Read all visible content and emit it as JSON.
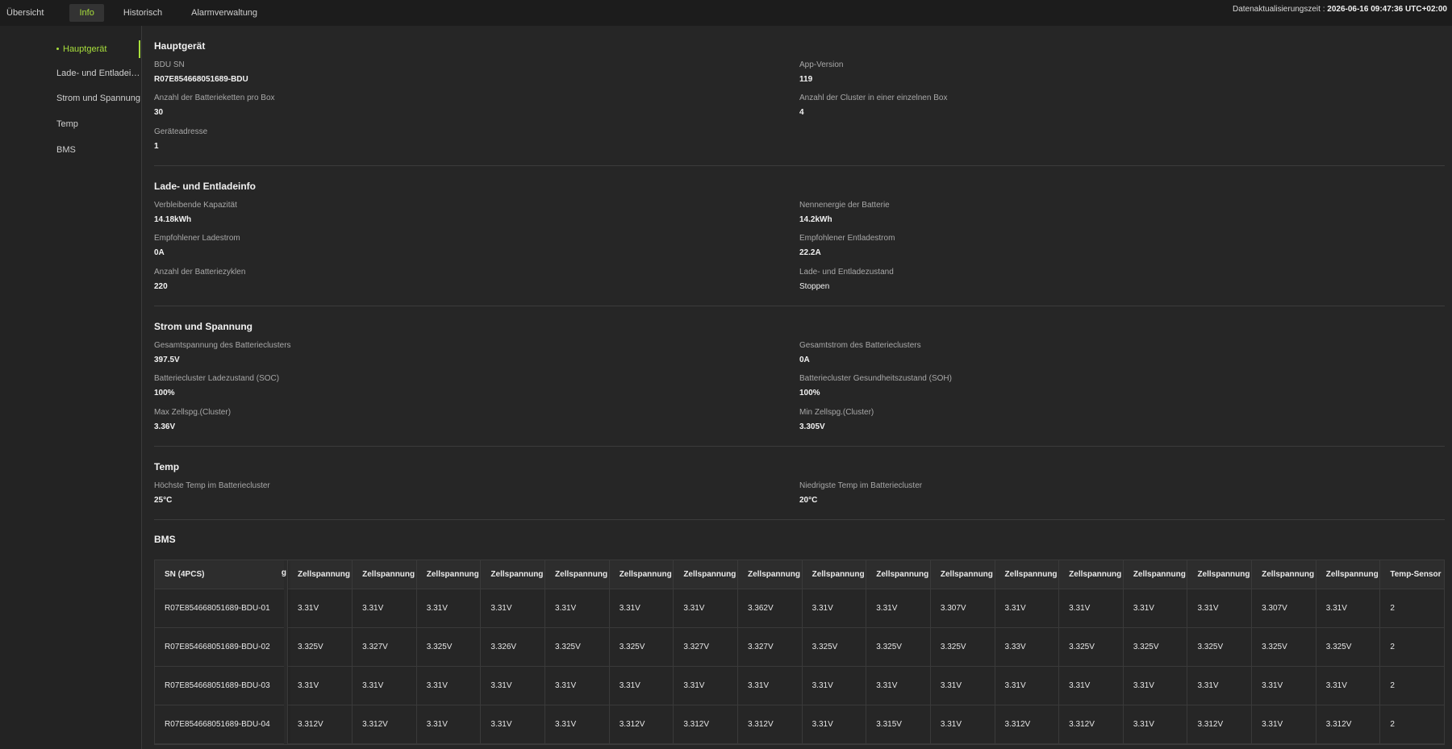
{
  "tabs": [
    "Übersicht",
    "Info",
    "Historisch",
    "Alarmverwaltung"
  ],
  "update": {
    "label": "Datenaktualisierungszeit :",
    "time": "2026-06-16 09:47:36 UTC+02:00"
  },
  "sidebar": {
    "items": [
      {
        "label": "Hauptgerät"
      },
      {
        "label": "Lade- und Entladeinfo"
      },
      {
        "label": "Strom und Spannung"
      },
      {
        "label": "Temp"
      },
      {
        "label": "BMS"
      }
    ]
  },
  "sections": {
    "main": {
      "title": "Hauptgerät",
      "fields": [
        {
          "label": "BDU SN",
          "value": "R07E854668051689-BDU"
        },
        {
          "label": "App-Version",
          "value": "119"
        },
        {
          "label": "Anzahl der Batterieketten pro Box",
          "value": "30"
        },
        {
          "label": "Anzahl der Cluster in einer einzelnen Box",
          "value": "4"
        },
        {
          "label": "Geräteadresse",
          "value": "1"
        }
      ]
    },
    "charge": {
      "title": "Lade- und Entladeinfo",
      "fields": [
        {
          "label": "Verbleibende Kapazität",
          "value": "14.18kWh"
        },
        {
          "label": "Nennenergie der Batterie",
          "value": "14.2kWh"
        },
        {
          "label": "Empfohlener Ladestrom",
          "value": "0A"
        },
        {
          "label": "Empfohlener Entladestrom",
          "value": "22.2A"
        },
        {
          "label": "Anzahl der Batteriezyklen",
          "value": "220"
        },
        {
          "label": "Lade- und Entladezustand",
          "value": "Stoppen"
        }
      ]
    },
    "power": {
      "title": "Strom und Spannung",
      "fields": [
        {
          "label": "Gesamtspannung des Batterieclusters",
          "value": "397.5V"
        },
        {
          "label": "Gesamtstrom des Batterieclusters",
          "value": "0A"
        },
        {
          "label": "Batteriecluster Ladezustand (SOC)",
          "value": "100%"
        },
        {
          "label": "Batteriecluster Gesundheitszustand (SOH)",
          "value": "100%"
        },
        {
          "label": "Max Zellspg.(Cluster)",
          "value": "3.36V"
        },
        {
          "label": "Min Zellspg.(Cluster)",
          "value": "3.305V"
        }
      ]
    },
    "temp": {
      "title": "Temp",
      "fields": [
        {
          "label": "Höchste Temp im Batteriecluster",
          "value": "25°C"
        },
        {
          "label": "Niedrigste Temp im Batteriecluster",
          "value": "20°C"
        }
      ]
    },
    "bms": {
      "title": "BMS"
    }
  },
  "bms_table": {
    "sn_header": "SN (4PCS)",
    "partial_header": "g",
    "headers": [
      "Zellspannung",
      "Zellspannung",
      "Zellspannung",
      "Zellspannung",
      "Zellspannung",
      "Zellspannung",
      "Zellspannung",
      "Zellspannung",
      "Zellspannung",
      "Zellspannung",
      "Zellspannung",
      "Zellspannung",
      "Zellspannung",
      "Zellspannung",
      "Zellspannung",
      "Zellspannung",
      "Zellspannung",
      "Temp-Sensor"
    ],
    "rows": [
      {
        "sn": "R07E854668051689-BDU-01",
        "cells": [
          "3.31V",
          "3.31V",
          "3.31V",
          "3.31V",
          "3.31V",
          "3.31V",
          "3.31V",
          "3.362V",
          "3.31V",
          "3.31V",
          "3.307V",
          "3.31V",
          "3.31V",
          "3.31V",
          "3.31V",
          "3.307V",
          "3.31V",
          "2"
        ]
      },
      {
        "sn": "R07E854668051689-BDU-02",
        "cells": [
          "3.325V",
          "3.327V",
          "3.325V",
          "3.326V",
          "3.325V",
          "3.325V",
          "3.327V",
          "3.327V",
          "3.325V",
          "3.325V",
          "3.325V",
          "3.33V",
          "3.325V",
          "3.325V",
          "3.325V",
          "3.325V",
          "3.325V",
          "2"
        ]
      },
      {
        "sn": "R07E854668051689-BDU-03",
        "cells": [
          "3.31V",
          "3.31V",
          "3.31V",
          "3.31V",
          "3.31V",
          "3.31V",
          "3.31V",
          "3.31V",
          "3.31V",
          "3.31V",
          "3.31V",
          "3.31V",
          "3.31V",
          "3.31V",
          "3.31V",
          "3.31V",
          "3.31V",
          "2"
        ]
      },
      {
        "sn": "R07E854668051689-BDU-04",
        "cells": [
          "3.312V",
          "3.312V",
          "3.31V",
          "3.31V",
          "3.31V",
          "3.312V",
          "3.312V",
          "3.312V",
          "3.31V",
          "3.315V",
          "3.31V",
          "3.312V",
          "3.312V",
          "3.31V",
          "3.312V",
          "3.31V",
          "3.312V",
          "2"
        ]
      }
    ]
  }
}
